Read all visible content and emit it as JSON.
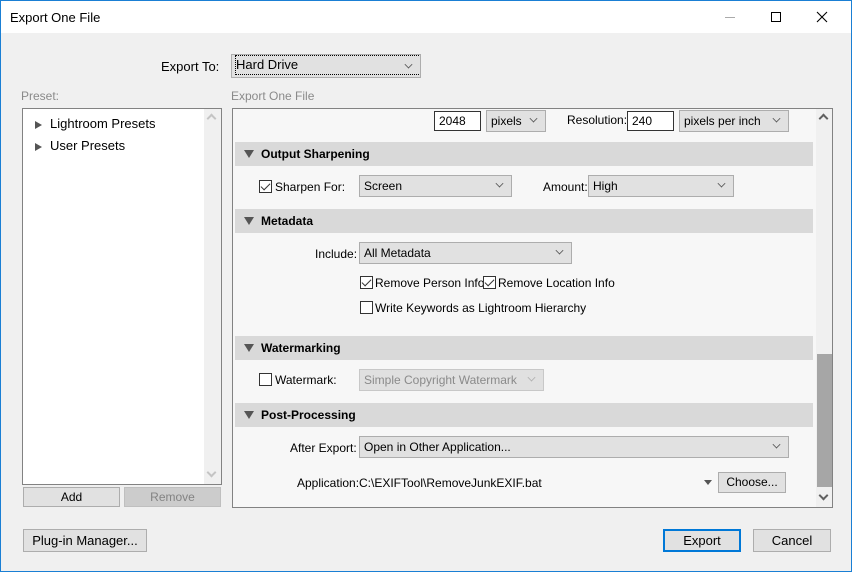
{
  "window": {
    "title": "Export One File",
    "controls": {
      "minimize": "minimize-icon",
      "maximize": "maximize-icon",
      "close": "close-icon"
    }
  },
  "export_to": {
    "label": "Export To:",
    "value": "Hard Drive"
  },
  "preset_panel": {
    "label": "Preset:",
    "items": [
      {
        "label": "Lightroom Presets",
        "icon": "triangle-right-icon"
      },
      {
        "label": "User Presets",
        "icon": "triangle-right-icon"
      }
    ],
    "add_label": "Add",
    "remove_label": "Remove"
  },
  "settings_panel": {
    "label": "Export One File",
    "image_sizing": {
      "size_value": "2048",
      "size_unit": "pixels",
      "resolution_label": "Resolution:",
      "resolution_value": "240",
      "resolution_unit": "pixels per inch"
    },
    "output_sharpening": {
      "title": "Output Sharpening",
      "sharpen_for_label": "Sharpen For:",
      "sharpen_for_checked": true,
      "sharpen_for_value": "Screen",
      "amount_label": "Amount:",
      "amount_value": "High"
    },
    "metadata": {
      "title": "Metadata",
      "include_label": "Include:",
      "include_value": "All Metadata",
      "remove_person_label": "Remove Person Info",
      "remove_person_checked": true,
      "remove_location_label": "Remove Location Info",
      "remove_location_checked": true,
      "write_keywords_label": "Write Keywords as Lightroom Hierarchy",
      "write_keywords_checked": false
    },
    "watermarking": {
      "title": "Watermarking",
      "watermark_label": "Watermark:",
      "watermark_checked": false,
      "watermark_value": "Simple Copyright Watermark"
    },
    "post_processing": {
      "title": "Post-Processing",
      "after_export_label": "After Export:",
      "after_export_value": "Open in Other Application...",
      "application_label": "Application:",
      "application_value": "C:\\EXIFTool\\RemoveJunkEXIF.bat",
      "choose_label": "Choose..."
    }
  },
  "footer": {
    "plugin_manager_label": "Plug-in Manager...",
    "export_label": "Export",
    "cancel_label": "Cancel"
  }
}
